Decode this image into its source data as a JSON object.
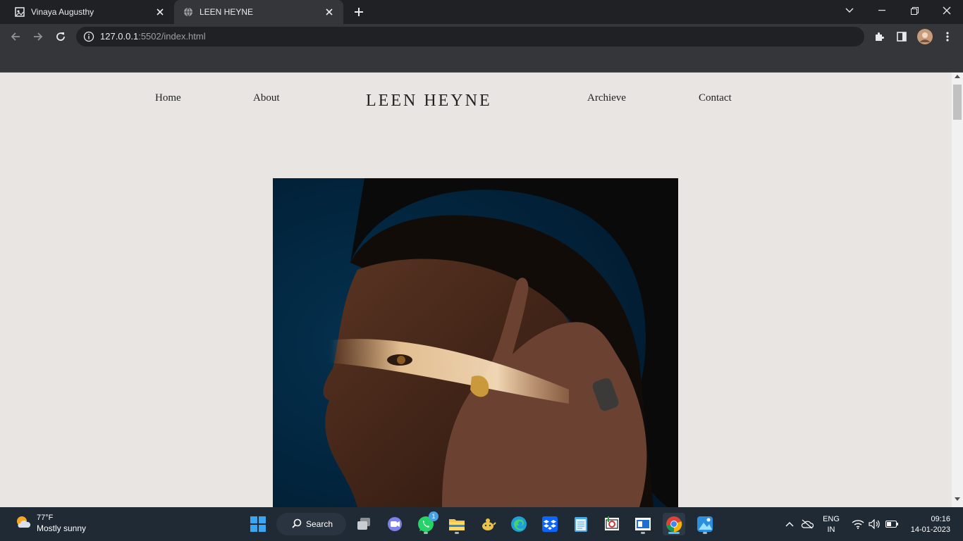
{
  "browser": {
    "tabs": [
      {
        "title": "Vinaya Augusthy",
        "active": false
      },
      {
        "title": "LEEN HEYNE",
        "active": true
      }
    ],
    "address_host": "127.0.0.1",
    "address_path": ":5502/index.html"
  },
  "site": {
    "logo": "LEEN HEYNE",
    "nav_left": [
      "Home",
      "About"
    ],
    "nav_right": [
      "Archieve",
      "Contact"
    ]
  },
  "taskbar": {
    "weather_temp": "77°F",
    "weather_desc": "Mostly sunny",
    "search_label": "Search",
    "whatsapp_badge": "1",
    "lang_line1": "ENG",
    "lang_line2": "IN",
    "time": "09:16",
    "date": "14-01-2023"
  },
  "colors": {
    "page_bg": "#e8e5e2",
    "chrome_dark": "#202124",
    "chrome_toolbar": "#35363a",
    "taskbar_bg": "#1f2a35",
    "hero_bg": "#02233d"
  }
}
